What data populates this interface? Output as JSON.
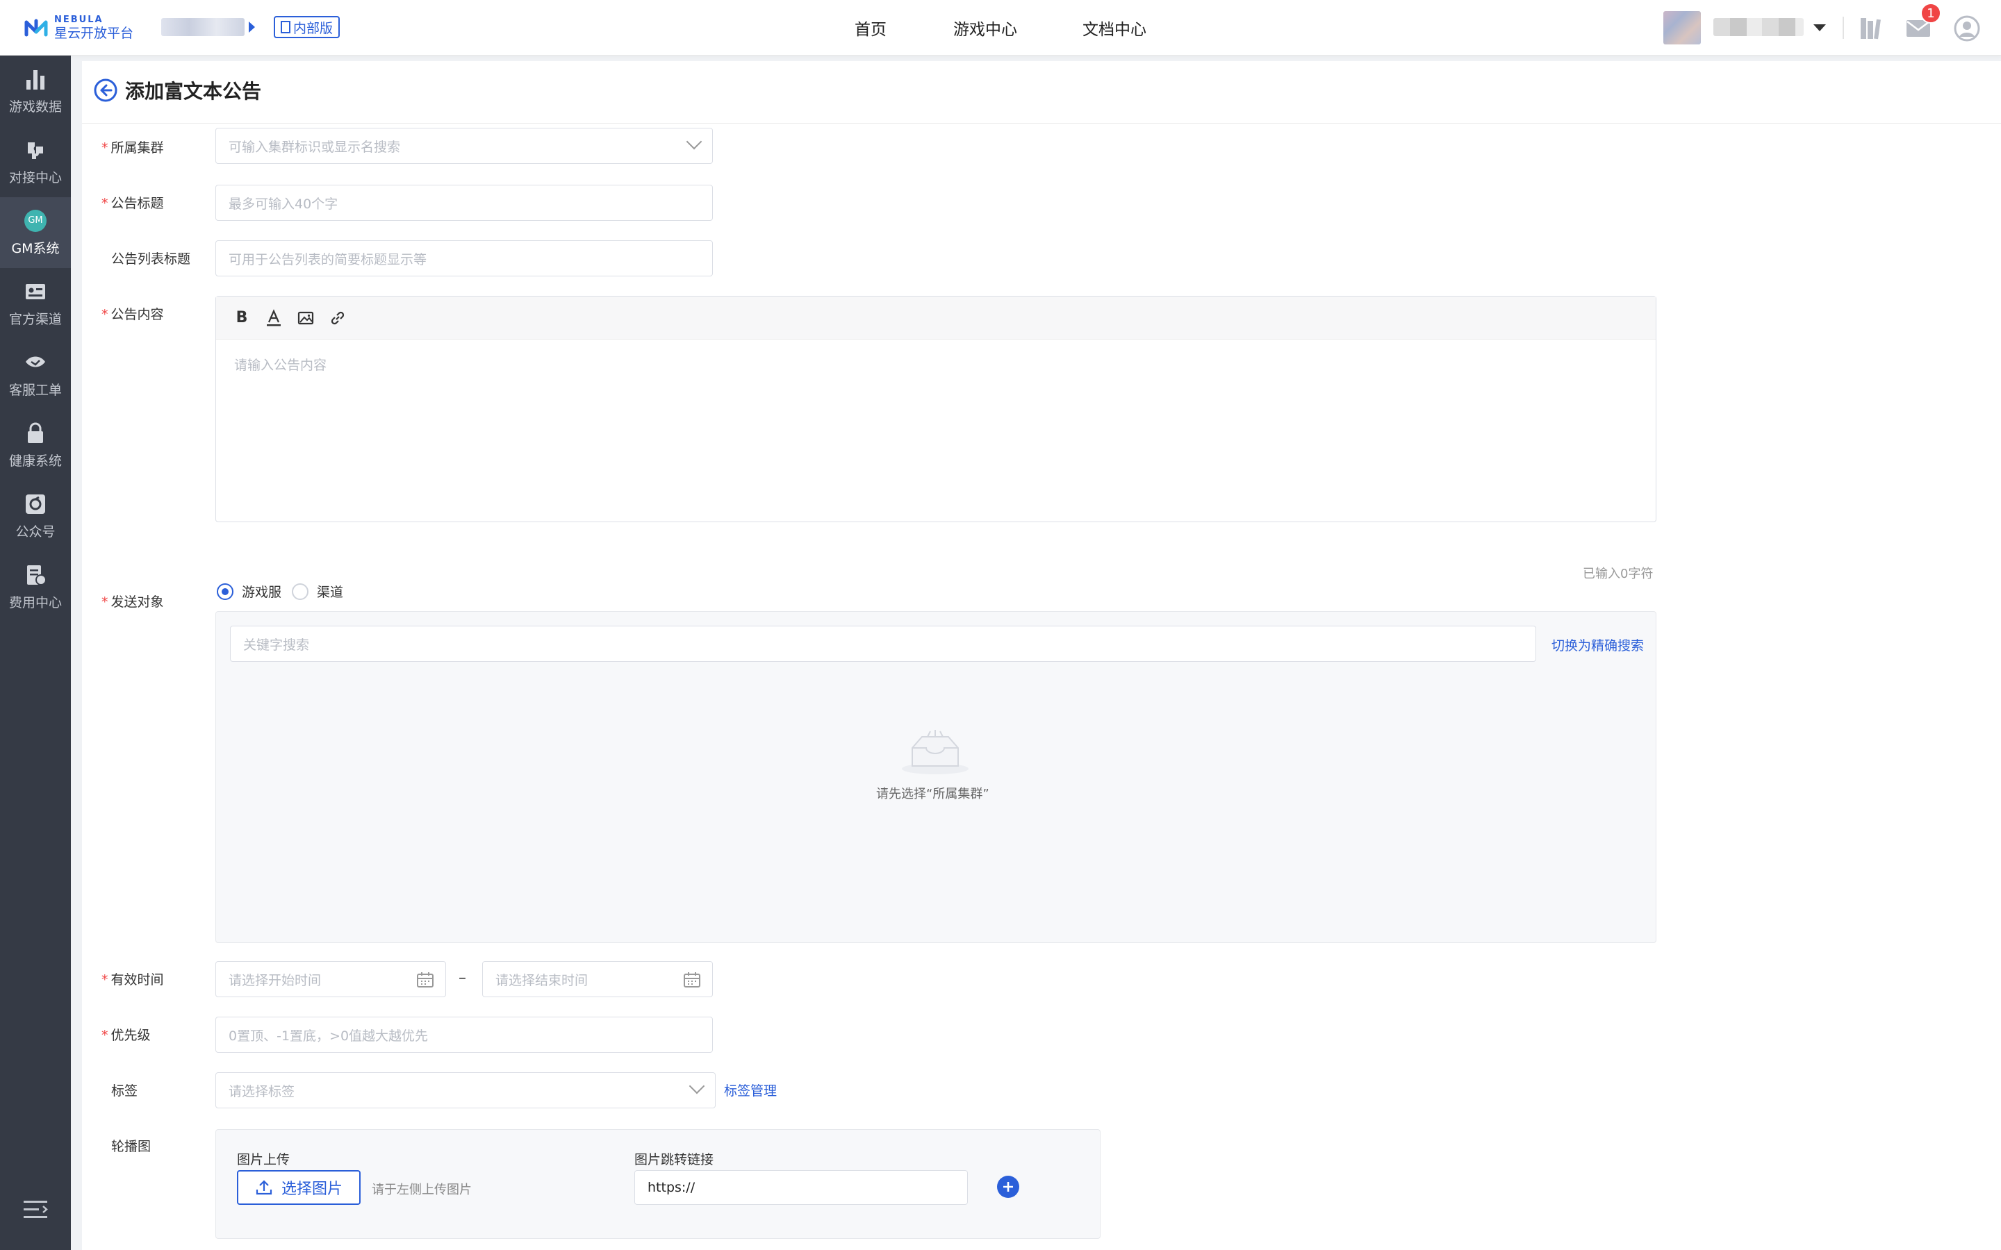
{
  "header": {
    "logo_en": "NEBULA",
    "logo_cn": "星云开放平台",
    "badge": "内部版",
    "nav": [
      "首页",
      "游戏中心",
      "文档中心"
    ],
    "notification_count": "1"
  },
  "sidebar": {
    "items": [
      {
        "label": "游戏数据",
        "icon": "bar-chart-icon"
      },
      {
        "label": "对接中心",
        "icon": "puzzle-icon"
      },
      {
        "label": "GM系统",
        "icon": "gm-icon",
        "badge": "GM"
      },
      {
        "label": "官方渠道",
        "icon": "id-card-icon"
      },
      {
        "label": "客服工单",
        "icon": "service-icon"
      },
      {
        "label": "健康系统",
        "icon": "lock-icon"
      },
      {
        "label": "公众号",
        "icon": "share-icon"
      },
      {
        "label": "费用中心",
        "icon": "bill-icon"
      }
    ],
    "active_index": 2
  },
  "page": {
    "title": "添加富文本公告"
  },
  "form": {
    "cluster": {
      "label": "所属集群",
      "placeholder": "可输入集群标识或显示名搜索"
    },
    "title": {
      "label": "公告标题",
      "placeholder": "最多可输入40个字"
    },
    "list_title": {
      "label": "公告列表标题",
      "placeholder": "可用于公告列表的简要标题显示等"
    },
    "content": {
      "label": "公告内容",
      "placeholder": "请输入公告内容",
      "counter": "已输入0字符"
    },
    "target": {
      "label": "发送对象",
      "options": [
        "游戏服",
        "渠道"
      ],
      "selected": "游戏服",
      "search_placeholder": "关键字搜索",
      "switch_link": "切换为精确搜索",
      "empty_text": "请先选择“所属集群”"
    },
    "valid_time": {
      "label": "有效时间",
      "start_placeholder": "请选择开始时间",
      "end_placeholder": "请选择结束时间",
      "separator": "–"
    },
    "priority": {
      "label": "优先级",
      "placeholder": "0置顶、-1置底，>0值越大越优先"
    },
    "tags": {
      "label": "标签",
      "placeholder": "请选择标签",
      "manage_link": "标签管理"
    },
    "carousel": {
      "label": "轮播图",
      "upload_label": "图片上传",
      "upload_button": "选择图片",
      "upload_hint": "请于左侧上传图片",
      "link_label": "图片跳转链接",
      "link_value": "https://"
    }
  },
  "colors": {
    "accent": "#2b5fd9",
    "sidebar_bg": "#353a45",
    "required": "#f04545"
  }
}
